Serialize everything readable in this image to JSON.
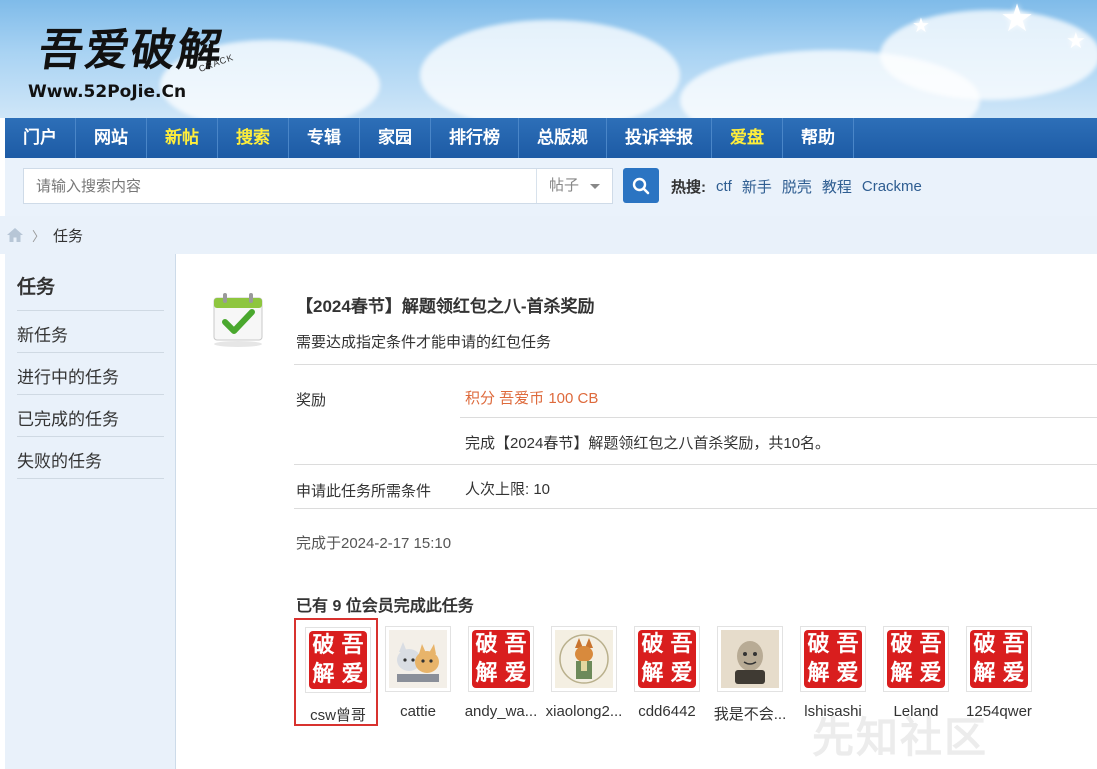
{
  "logo": {
    "cn": "吾爱破解",
    "crack": "CRACK",
    "url": "Www.52PoJie.Cn"
  },
  "nav": [
    {
      "label": "门户",
      "highlight": false
    },
    {
      "label": "网站",
      "highlight": false
    },
    {
      "label": "新帖",
      "highlight": true
    },
    {
      "label": "搜索",
      "highlight": true
    },
    {
      "label": "专辑",
      "highlight": false
    },
    {
      "label": "家园",
      "highlight": false
    },
    {
      "label": "排行榜",
      "highlight": false
    },
    {
      "label": "总版规",
      "highlight": false
    },
    {
      "label": "投诉举报",
      "highlight": false
    },
    {
      "label": "爱盘",
      "highlight": true
    },
    {
      "label": "帮助",
      "highlight": false
    }
  ],
  "search": {
    "placeholder": "请输入搜索内容",
    "type": "帖子",
    "button_icon": "search-icon",
    "hot_label": "热搜:",
    "hot_links": [
      "ctf",
      "新手",
      "脱壳",
      "教程",
      "Crackme"
    ]
  },
  "breadcrumb": {
    "home_icon": "home-icon",
    "current": "任务"
  },
  "sidebar": {
    "title": "任务",
    "items": [
      "新任务",
      "进行中的任务",
      "已完成的任务",
      "失败的任务"
    ]
  },
  "task": {
    "icon": "task-check-icon",
    "title": "【2024春节】解题领红包之八-首杀奖励",
    "description": "需要达成指定条件才能申请的红包任务",
    "reward_label": "奖励",
    "reward_value": "积分 吾爱币 100 CB",
    "reward_note": "完成【2024春节】解题领红包之八首杀奖励，共10名。",
    "condition_label": "申请此任务所需条件",
    "condition_value": "人次上限: 10",
    "completed_at": "完成于2024-2-17 15:10",
    "members_title": "已有 9 位会员完成此任务"
  },
  "members": [
    {
      "name": "csw曾哥",
      "avatar": "seal",
      "selected": true
    },
    {
      "name": "cattie",
      "avatar": "cats",
      "selected": false
    },
    {
      "name": "andy_wa...",
      "avatar": "seal",
      "selected": false
    },
    {
      "name": "xiaolong2...",
      "avatar": "fox",
      "selected": false
    },
    {
      "name": "cdd6442",
      "avatar": "seal",
      "selected": false
    },
    {
      "name": "我是不会...",
      "avatar": "figure",
      "selected": false
    },
    {
      "name": "lshisashi",
      "avatar": "seal",
      "selected": false
    },
    {
      "name": "Leland",
      "avatar": "seal",
      "selected": false
    },
    {
      "name": "1254qwer",
      "avatar": "seal",
      "selected": false
    }
  ],
  "seal_chars": [
    "破",
    "吾",
    "解",
    "爱"
  ],
  "watermark": "先知社区",
  "colors": {
    "nav_bg": "#1d5ba5",
    "nav_highlight": "#ffee3b",
    "reward": "#de6a3c",
    "selected_border": "#d8322f",
    "seal_red": "#d91e1e"
  }
}
